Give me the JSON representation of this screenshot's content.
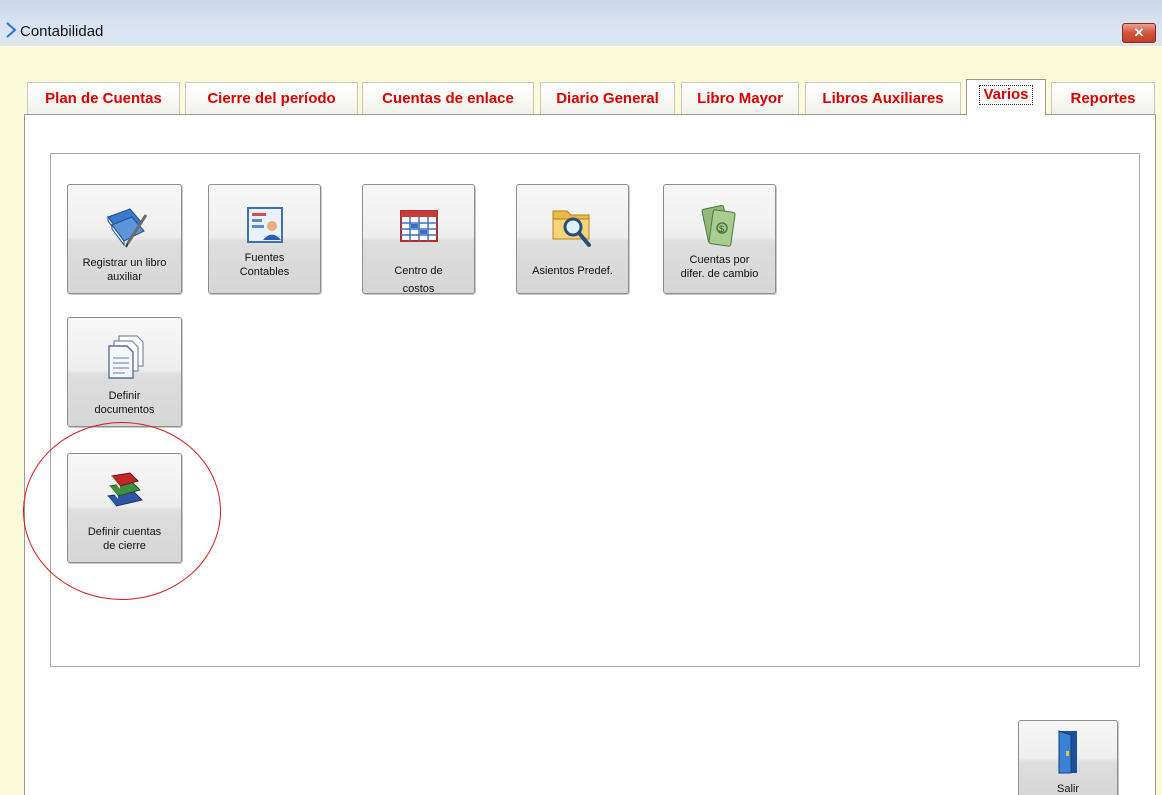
{
  "window": {
    "title": "Contabilidad",
    "close_label": "✕"
  },
  "tabs": [
    {
      "label": "Plan de Cuentas"
    },
    {
      "label": "Cierre del período"
    },
    {
      "label": "Cuentas de enlace"
    },
    {
      "label": "Diario General"
    },
    {
      "label": "Libro Mayor"
    },
    {
      "label": "Libros Auxiliares"
    },
    {
      "label": "Varios",
      "active": true
    },
    {
      "label": "Reportes"
    }
  ],
  "buttons": {
    "registrar_libro_auxiliar": {
      "line1": "Registrar un libro",
      "line2": "auxiliar",
      "icon": "books-pen-icon"
    },
    "fuentes_contables": {
      "line1": "Fuentes",
      "line2": "Contables",
      "icon": "form-user-icon"
    },
    "centro_de_costos": {
      "line1": "Centro de",
      "line2": "costos",
      "icon": "table-grid-icon"
    },
    "asientos_predef": {
      "line1": "Asientos Predef.",
      "icon": "folder-search-icon"
    },
    "cuentas_difer_cambio": {
      "line1": "Cuentas por",
      "line2": "difer. de cambio",
      "icon": "money-icon"
    },
    "definir_documentos": {
      "line1": "Definir",
      "line2": "documentos",
      "icon": "documents-icon"
    },
    "definir_cuentas_cierre": {
      "line1": "Definir cuentas",
      "line2": "de cierre",
      "icon": "books-stack-icon"
    },
    "salir": {
      "line1": "Salir",
      "icon": "door-exit-icon"
    }
  },
  "colors": {
    "tab_text": "#d90000",
    "window_bg": "#fbfbda",
    "highlight": "#d21c1c"
  }
}
